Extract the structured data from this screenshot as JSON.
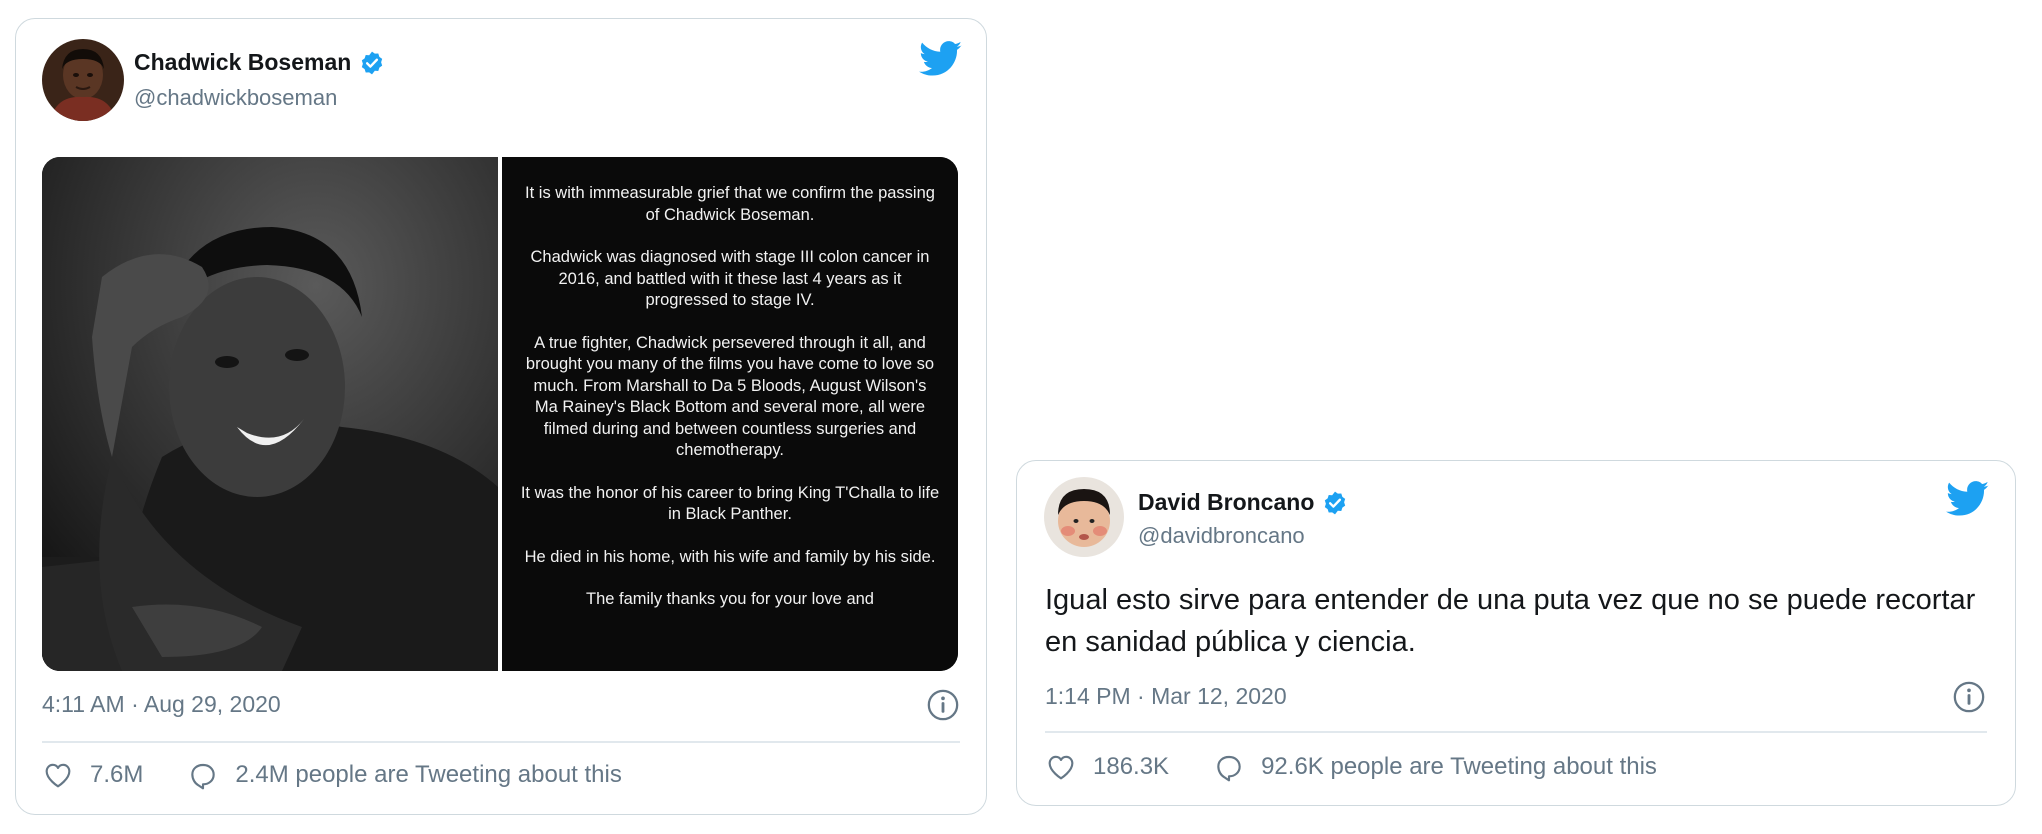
{
  "tweets": [
    {
      "author_name": "Chadwick Boseman",
      "handle": "@chadwickboseman",
      "timestamp": "4:11 AM · Aug 29, 2020",
      "likes": "7.6M",
      "tweeting": "2.4M people are Tweeting about this",
      "statement": [
        "It is with immeasurable grief that we confirm the passing of Chadwick Boseman.",
        "Chadwick was diagnosed with stage III colon cancer in 2016, and battled with it these last 4 years as it progressed to stage IV.",
        "A true fighter, Chadwick persevered through it all, and brought you many of the films you have come to love so much. From Marshall to Da 5 Bloods, August Wilson's Ma Rainey's Black Bottom and several more, all were filmed during and between countless surgeries and chemotherapy.",
        "It was the honor of his career to bring King T'Challa to life in Black Panther.",
        "He died in his home, with his wife and family by his side.",
        "The family thanks you for your love and"
      ]
    },
    {
      "author_name": "David Broncano",
      "handle": "@davidbroncano",
      "text": "Igual esto sirve para entender de una puta vez que no se puede recortar en sanidad pública y ciencia.",
      "timestamp": "1:14 PM · Mar 12, 2020",
      "likes": "186.3K",
      "tweeting": "92.6K people are Tweeting about this"
    }
  ],
  "icons": {
    "verified": "verified-badge-icon",
    "bird": "twitter-bird-icon",
    "heart": "heart-icon",
    "reply": "reply-bubble-icon",
    "info": "info-icon"
  },
  "colors": {
    "twitter_blue": "#1da1f2",
    "secondary_text": "#657786",
    "border": "#cfd9de"
  }
}
